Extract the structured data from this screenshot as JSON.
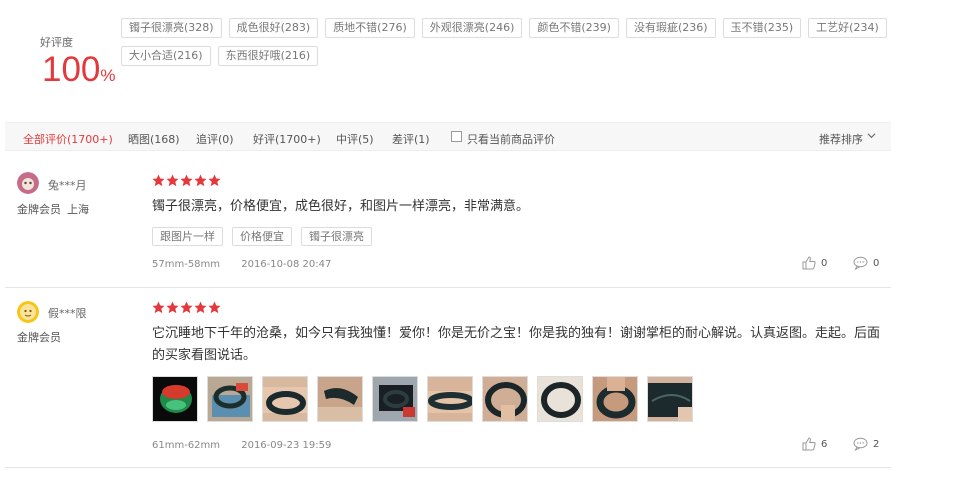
{
  "summary": {
    "rate_label": "好评度",
    "rate_value": "100",
    "rate_unit": "%",
    "tags": [
      "镯子很漂亮(328)",
      "成色很好(283)",
      "质地不错(276)",
      "外观很漂亮(246)",
      "颜色不错(239)",
      "没有瑕疵(236)",
      "玉不错(235)",
      "工艺好(234)",
      "大小合适(216)",
      "东西很好哦(216)"
    ]
  },
  "filter": {
    "tabs": [
      "全部评价(1700+)",
      "晒图(168)",
      "追评(0)",
      "好评(1700+)",
      "中评(5)",
      "差评(1)"
    ],
    "current_only_label": "只看当前商品评价",
    "sort_label": "推荐排序"
  },
  "reviews": [
    {
      "username": "兔***月",
      "level": "金牌会员",
      "location": "上海",
      "stars": 5,
      "text": "镯子很漂亮，价格便宜，成色很好，和图片一样漂亮，非常满意。",
      "tags": [
        "跟图片一样",
        "价格便宜",
        "镯子很漂亮"
      ],
      "size": "57mm-58mm",
      "date": "2016-10-08 20:47",
      "likes": "0",
      "replies": "0"
    },
    {
      "username": "假***限",
      "level": "金牌会员",
      "stars": 5,
      "text": "它沉睡地下千年的沧桑，如今只有我独懂！爱你！你是无价之宝！你是我的独有！谢谢掌柜的耐心解说。认真返图。走起。后面的买家看图说话。",
      "photo_count": 10,
      "size": "61mm-62mm",
      "date": "2016-09-23 19:59",
      "likes": "6",
      "replies": "2"
    }
  ],
  "colors": {
    "accent": "#e4393c",
    "border": "#dcdcdc"
  }
}
